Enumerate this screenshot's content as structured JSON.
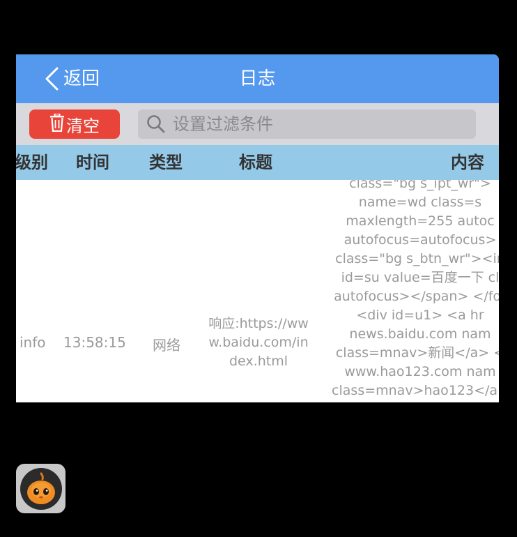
{
  "navbar": {
    "back_label": "返回",
    "title": "日志"
  },
  "toolbar": {
    "clear_label": "清空",
    "search_placeholder": "设置过滤条件",
    "search_value": ""
  },
  "table": {
    "columns": [
      "级别",
      "时间",
      "类型",
      "标题",
      "内容"
    ],
    "rows": [
      {
        "level": "info",
        "time": "13:58:15",
        "type": "网络",
        "title": "响应:https://www.baidu.com/index.html",
        "content": "class=\"bg s_ipt_wr\">\nname=wd class=s\nmaxlength=255 autoc\nautofocus=autofocus>\nclass=\"bg s_btn_wr\"><in\nid=su value=百度一下 cl\nautofocus></span> </for\n<div id=u1> <a hr\nnews.baidu.com nam\nclass=mnav>新闻</a> <\nwww.hao123.com nam\nclass=mnav>hao123</a>"
      }
    ]
  },
  "colors": {
    "navbar": "#5599ee",
    "toolbar": "#d8d8dd",
    "clear_button": "#e8443a",
    "header": "#94c9e8",
    "cell_text": "#9a9a9a"
  },
  "icons": {
    "back": "chevron-left-icon",
    "clear": "trash-icon",
    "search": "search-icon",
    "app": "pumpkin-app-icon"
  }
}
